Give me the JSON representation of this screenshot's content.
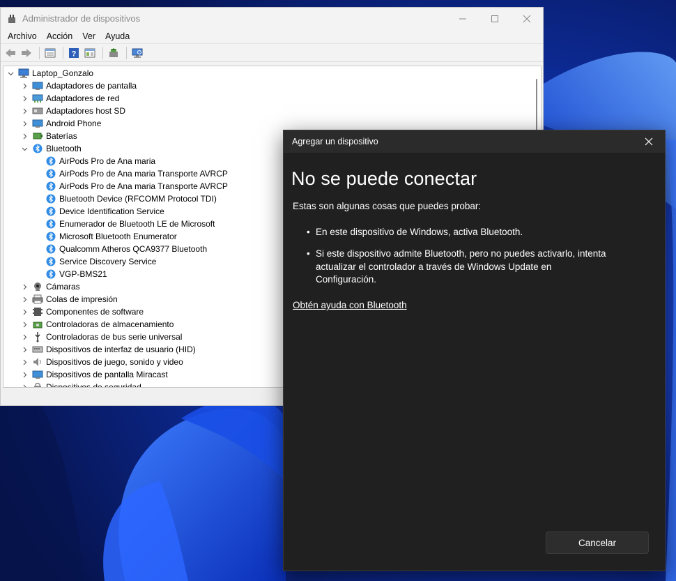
{
  "colors": {
    "wallpaper_blue": "#1747d6",
    "dialog_bg": "#202020",
    "bluetooth_blue": "#2f8be6"
  },
  "device_manager": {
    "title": "Administrador de dispositivos",
    "menu": [
      "Archivo",
      "Acción",
      "Ver",
      "Ayuda"
    ],
    "toolbar_icons": [
      "back-icon",
      "forward-icon",
      "properties-icon",
      "help-icon",
      "view-icon",
      "update-driver-icon",
      "scan-hardware-icon"
    ],
    "tree": {
      "root": "Laptop_Gonzalo",
      "categories_before": [
        {
          "label": "Adaptadores de pantalla",
          "icon": "display-adapter-icon"
        },
        {
          "label": "Adaptadores de red",
          "icon": "network-adapter-icon"
        },
        {
          "label": "Adaptadores host SD",
          "icon": "sd-host-icon"
        },
        {
          "label": "Android Phone",
          "icon": "android-phone-icon"
        },
        {
          "label": "Baterías",
          "icon": "battery-icon"
        }
      ],
      "expanded_category": {
        "label": "Bluetooth",
        "children": [
          "AirPods Pro de Ana maria",
          "AirPods Pro de Ana maria Transporte AVRCP",
          "AirPods Pro de Ana maria Transporte AVRCP",
          "Bluetooth Device (RFCOMM Protocol TDI)",
          "Device Identification Service",
          "Enumerador de Bluetooth LE de Microsoft",
          "Microsoft Bluetooth Enumerator",
          "Qualcomm Atheros QCA9377 Bluetooth",
          "Service Discovery Service",
          "VGP-BMS21"
        ]
      },
      "categories_after": [
        {
          "label": "Cámaras",
          "icon": "camera-icon"
        },
        {
          "label": "Colas de impresión",
          "icon": "printer-icon"
        },
        {
          "label": "Componentes de software",
          "icon": "software-component-icon"
        },
        {
          "label": "Controladoras de almacenamiento",
          "icon": "storage-controller-icon"
        },
        {
          "label": "Controladoras de bus serie universal",
          "icon": "usb-icon"
        },
        {
          "label": "Dispositivos de interfaz de usuario (HID)",
          "icon": "hid-icon"
        },
        {
          "label": "Dispositivos de juego, sonido y video",
          "icon": "sound-icon"
        },
        {
          "label": "Dispositivos de pantalla Miracast",
          "icon": "miracast-icon"
        },
        {
          "label": "Dispositivos de seguridad",
          "icon": "security-device-icon"
        }
      ]
    }
  },
  "dialog": {
    "title": "Agregar un dispositivo",
    "heading": "No se puede conectar",
    "subtitle": "Estas son algunas cosas que puedes probar:",
    "tips": [
      "En este dispositivo de Windows, activa Bluetooth.",
      "Si este dispositivo admite Bluetooth, pero no puedes activarlo, intenta actualizar el controlador a través de Windows Update en Configuración."
    ],
    "help_link": "Obtén ayuda con Bluetooth",
    "cancel_label": "Cancelar"
  }
}
